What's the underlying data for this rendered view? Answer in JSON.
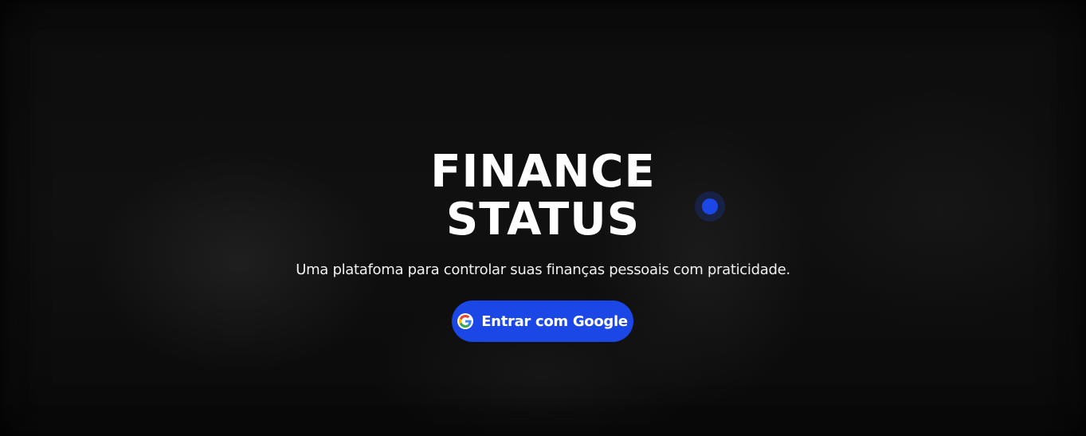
{
  "hero": {
    "title_line1": "FINANCE",
    "title_line2": "STATUS",
    "subtitle": "Uma platafoma para controlar suas finanças pessoais com praticidade.",
    "login_button": {
      "label": "Entrar com Google",
      "icon": "google-icon"
    }
  },
  "colors": {
    "accent": "#1a47e6",
    "background": "#0b0b0b",
    "text": "#ffffff"
  }
}
